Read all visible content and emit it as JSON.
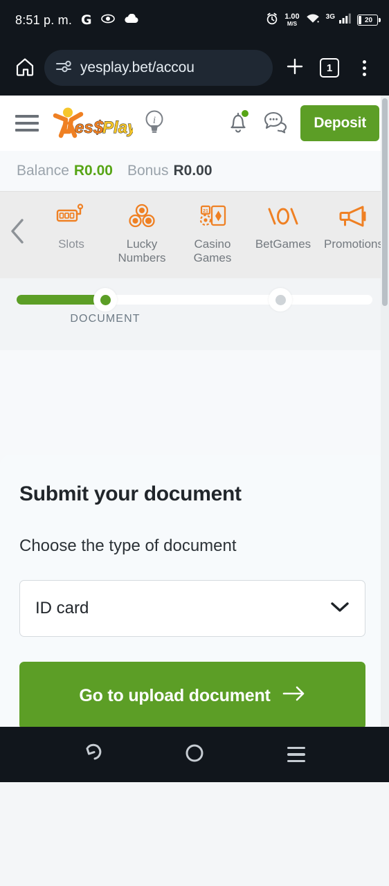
{
  "status_bar": {
    "time": "8:51 p. m.",
    "left_icons": [
      "google-icon",
      "eye-icon",
      "cloud-icon"
    ],
    "net_speed_value": "1.00",
    "net_speed_unit": "M/S",
    "network_type": "3G",
    "battery_percent": "20",
    "right_icons": [
      "alarm-icon",
      "wifi-icon",
      "signal-icon",
      "battery-icon"
    ]
  },
  "browser": {
    "home_icon": "home-icon",
    "site_settings_icon": "tune-icon",
    "url": "yesplay.bet/accou",
    "new_tab_icon": "plus-icon",
    "tab_count": "1",
    "menu_icon": "kebab-menu-icon"
  },
  "app_header": {
    "menu_icon": "hamburger-icon",
    "logo_text": "YesPlay",
    "info_icon": "lightbulb-info-icon",
    "notifications_icon": "bell-icon",
    "chat_icon": "chat-bubble-icon",
    "deposit_label": "Deposit"
  },
  "balance": {
    "balance_label": "Balance",
    "balance_value": "R0.00",
    "bonus_label": "Bonus",
    "bonus_value": "R0.00"
  },
  "category_nav": {
    "back_icon": "chevron-left-icon",
    "items": [
      {
        "label": "Slots",
        "icon": "slot-machine-icon"
      },
      {
        "label": "Lucky\nNumbers",
        "label_line1": "Lucky",
        "label_line2": "Numbers",
        "icon": "lottery-balls-icon"
      },
      {
        "label": "Casino\nGames",
        "label_line1": "Casino",
        "label_line2": "Games",
        "icon": "playing-cards-icon"
      },
      {
        "label": "BetGames",
        "icon": "betgames-logo-icon"
      },
      {
        "label": "Promotions",
        "icon": "megaphone-icon"
      }
    ]
  },
  "stepper": {
    "steps": [
      {
        "label": "DOCUMENT",
        "state": "active"
      },
      {
        "label": "",
        "state": "inactive"
      }
    ]
  },
  "content": {
    "title": "Submit your document",
    "subtitle": "Choose the type of document",
    "document_type_value": "ID card",
    "dropdown_icon": "chevron-down-icon",
    "cta_label": "Go to upload document",
    "cta_icon": "arrow-right-icon"
  },
  "nav_bar": {
    "back_icon": "back-arrow-icon",
    "home_icon": "home-circle-icon",
    "recents_icon": "recents-icon"
  },
  "colors": {
    "brand_green": "#5c9e26",
    "brand_orange": "#ef8023",
    "logo_yellow": "#f6c62b",
    "chrome_dark": "#11161c",
    "page_bg": "#f7f9fb"
  }
}
